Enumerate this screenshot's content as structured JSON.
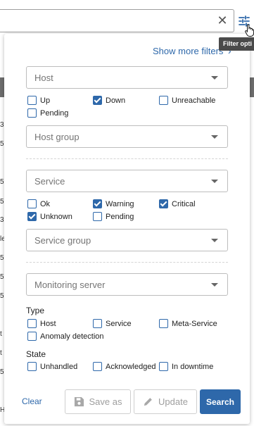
{
  "background": {
    "row_fragments": [
      "3",
      "5",
      "5",
      "5",
      "3",
      "le",
      "5",
      "5",
      "5",
      "t",
      "t",
      "5",
      "H"
    ]
  },
  "search": {
    "value": "",
    "clear_glyph": "✕"
  },
  "tooltip": {
    "text": "Filter opti"
  },
  "panel": {
    "show_more_label": "Show more filters",
    "host": {
      "select_label": "Host",
      "statuses": [
        {
          "label": "Up",
          "checked": false
        },
        {
          "label": "Down",
          "checked": true
        },
        {
          "label": "Unreachable",
          "checked": false
        },
        {
          "label": "Pending",
          "checked": false
        }
      ],
      "group_label": "Host group"
    },
    "service": {
      "select_label": "Service",
      "statuses": [
        {
          "label": "Ok",
          "checked": false
        },
        {
          "label": "Warning",
          "checked": true
        },
        {
          "label": "Critical",
          "checked": true
        },
        {
          "label": "Unknown",
          "checked": true
        },
        {
          "label": "Pending",
          "checked": false
        }
      ],
      "group_label": "Service group"
    },
    "monitoring_server_label": "Monitoring server",
    "type": {
      "heading": "Type",
      "options": [
        {
          "label": "Host",
          "checked": false
        },
        {
          "label": "Service",
          "checked": false
        },
        {
          "label": "Meta-Service",
          "checked": false
        },
        {
          "label": "Anomaly detection",
          "checked": false
        }
      ]
    },
    "state": {
      "heading": "State",
      "options": [
        {
          "label": "Unhandled",
          "checked": false
        },
        {
          "label": "Acknowledged",
          "checked": false
        },
        {
          "label": "In downtime",
          "checked": false
        }
      ]
    },
    "actions": {
      "clear": "Clear",
      "save_as": "Save as",
      "update": "Update",
      "search": "Search"
    }
  },
  "colors": {
    "accent": "#2e68aa",
    "tooltip_bg": "#4a4a4a"
  },
  "icons": [
    "close-icon",
    "filter-options-icon",
    "mouse-cursor-icon",
    "chevron-right-icon",
    "dropdown-arrow-icon",
    "save-icon",
    "pencil-icon"
  ]
}
